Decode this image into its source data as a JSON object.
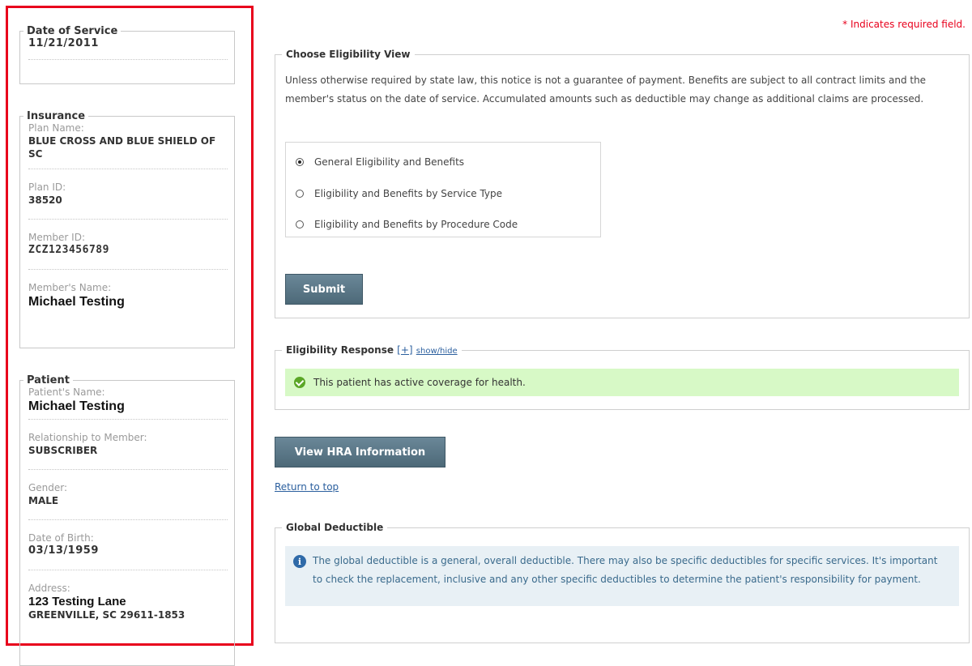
{
  "required_note": "* Indicates required field.",
  "sidebar": {
    "date_of_service": {
      "legend": "Date of Service",
      "value": "11/21/2011"
    },
    "insurance": {
      "legend": "Insurance",
      "plan_name_label": "Plan Name:",
      "plan_name": "BLUE CROSS AND BLUE SHIELD OF SC",
      "plan_id_label": "Plan ID:",
      "plan_id": "38520",
      "member_id_label": "Member ID:",
      "member_id": "ZCZ123456789",
      "member_name_label": "Member's Name:",
      "member_name": "Michael Testing"
    },
    "patient": {
      "legend": "Patient",
      "name_label": "Patient's Name:",
      "name": "Michael Testing",
      "relationship_label": "Relationship to Member:",
      "relationship": "SUBSCRIBER",
      "gender_label": "Gender:",
      "gender": "MALE",
      "dob_label": "Date of Birth:",
      "dob": "03/13/1959",
      "address_label": "Address:",
      "address_line1": "123 Testing Lane",
      "address_line2": "GREENVILLE, SC 29611-1853"
    }
  },
  "eligibility_view": {
    "legend": "Choose Eligibility View",
    "notice": "Unless otherwise required by state law, this notice is not a guarantee of payment. Benefits are subject to all contract limits and the member's status on the date of service. Accumulated amounts such as deductible may change as additional claims are processed.",
    "options": [
      {
        "label": "General Eligibility and Benefits",
        "checked": true
      },
      {
        "label": "Eligibility and Benefits by Service Type",
        "checked": false
      },
      {
        "label": "Eligibility and Benefits by Procedure Code",
        "checked": false
      }
    ],
    "submit_label": "Submit"
  },
  "eligibility_response": {
    "legend": "Eligibility Response",
    "toggle_plus": "[+]",
    "toggle_label": "show/hide",
    "message": "This patient has active coverage for health."
  },
  "hra_button_label": "View HRA Information",
  "return_to_top": "Return to top",
  "global_deductible": {
    "legend": "Global Deductible",
    "info": "The global deductible is a general, overall deductible. There may also be specific deductibles for specific services. It's important to check the replacement, inclusive and any other specific deductibles to determine the patient's responsibility for payment."
  },
  "colors": {
    "sidebar_border": "#e8001c",
    "button": "#5a7787",
    "success_bg": "#d7f9c6",
    "info_bg": "#e8f0f5",
    "required": "#e8001c"
  }
}
